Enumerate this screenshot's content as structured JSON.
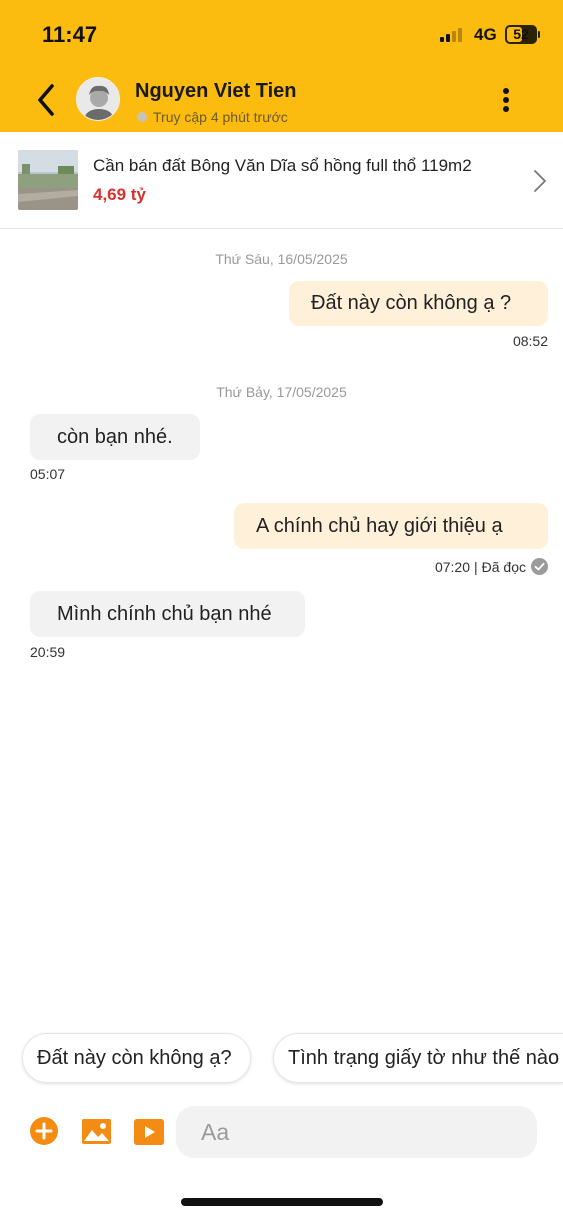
{
  "status_bar": {
    "time": "11:47",
    "network": "4G",
    "battery": "52"
  },
  "header": {
    "contact_name": "Nguyen Viet Tien",
    "presence": "Truy cập 4 phút trước",
    "back_icon": "chevron-left-icon",
    "more_icon": "more-vertical-icon",
    "accent_color": "#fcbb0f"
  },
  "listing": {
    "title": "Cần bán đất Bông Văn Dĩa sổ hồng full thổ 119m2",
    "price": "4,69 tỷ",
    "price_color": "#d8312e"
  },
  "messages": [
    {
      "type": "date",
      "text": "Thứ Sáu, 16/05/2025"
    },
    {
      "type": "out",
      "text": "Đất này còn không ạ ?",
      "time": "08:52"
    },
    {
      "type": "date",
      "text": "Thứ Bảy, 17/05/2025"
    },
    {
      "type": "in",
      "text": "còn bạn nhé.",
      "time": "05:07"
    },
    {
      "type": "out",
      "text": "A chính chủ hay giới thiệu ạ",
      "time": "07:20",
      "status": "Đã đọc"
    },
    {
      "type": "in",
      "text": "Mình chính chủ bạn nhé",
      "time": "20:59"
    }
  ],
  "quick_replies": [
    "Đất này còn không ạ?",
    "Tình trạng giấy tờ như thế nào"
  ],
  "composer": {
    "placeholder": "Aa",
    "tools": [
      "add-icon",
      "image-icon",
      "video-icon"
    ]
  }
}
